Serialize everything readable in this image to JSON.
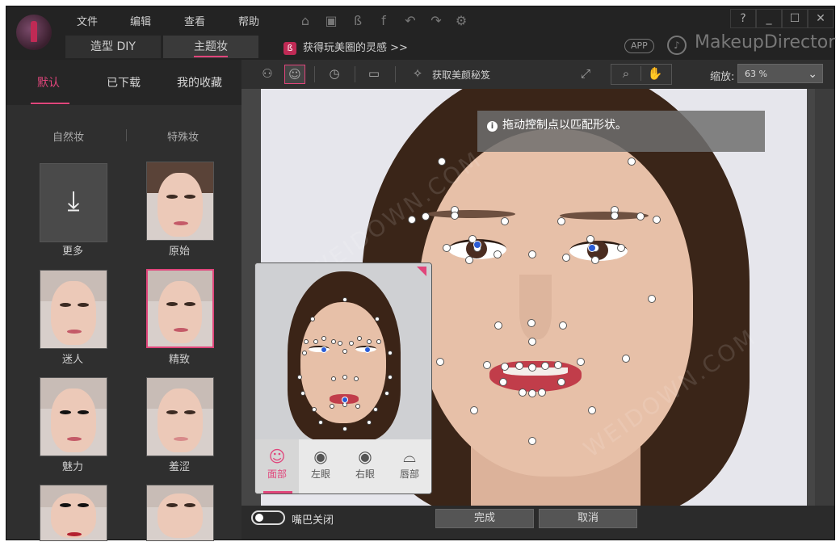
{
  "menu": {
    "file": "文件",
    "edit": "编辑",
    "view": "查看",
    "help": "帮助"
  },
  "tabs": {
    "diy": "造型 DIY",
    "theme": "主题妆"
  },
  "promo": {
    "icon": "ß",
    "text": "获得玩美圈的灵感 >>"
  },
  "app_badge": "APP",
  "brand": "MakeupDirector",
  "window": {
    "help": "?",
    "min": "_",
    "max": "☐",
    "close": "✕"
  },
  "left": {
    "tabs": [
      "默认",
      "已下载",
      "我的收藏"
    ],
    "subtabs": [
      "自然妆",
      "特殊妆"
    ],
    "thumbs": [
      "更多",
      "原始",
      "迷人",
      "精致",
      "魅力",
      "羞涩"
    ]
  },
  "toolbar": {
    "get_tips": "获取美颜秘笈",
    "zoom_label": "缩放:",
    "zoom_value": "63 %"
  },
  "tooltip": {
    "icon": "i",
    "text": "拖动控制点以匹配形状。"
  },
  "preview_tabs": [
    "面部",
    "左眼",
    "右眼",
    "唇部"
  ],
  "bottom": {
    "mouth_label": "嘴巴关闭",
    "done": "完成",
    "cancel": "取消"
  },
  "colors": {
    "accent": "#e0457b",
    "bg": "#2b2b2b"
  },
  "icons": [
    "home-icon",
    "save-icon",
    "beauty-circle-icon",
    "facebook-icon",
    "undo-icon",
    "redo-icon",
    "settings-icon",
    "bell-icon",
    "compare-icon",
    "face-outline-icon",
    "history-icon",
    "crop-icon",
    "face-tips-icon",
    "fullscreen-icon",
    "search-icon",
    "hand-icon"
  ],
  "watermark": "WEIDOWN.COM"
}
